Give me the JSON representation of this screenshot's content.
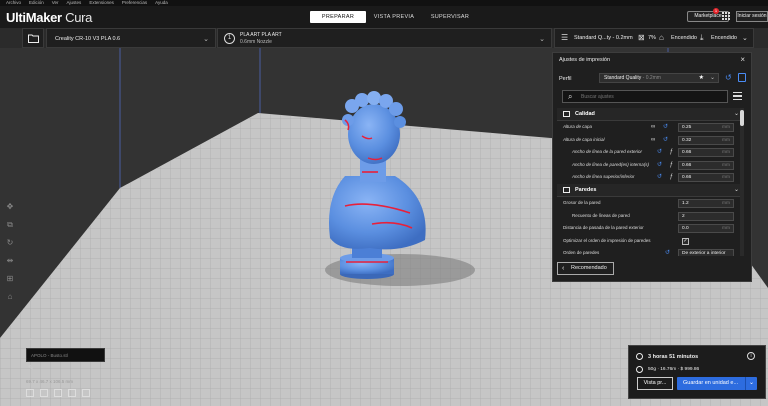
{
  "menu": [
    "Archivo",
    "Edición",
    "Ver",
    "Ajustes",
    "Extensiones",
    "Preferencias",
    "Ayuda"
  ],
  "app": {
    "brand_bold": "UltiMaker",
    "brand_light": " Cura"
  },
  "stages": [
    {
      "label": "PREPARAR",
      "active": true
    },
    {
      "label": "VISTA PREVIA",
      "active": false
    },
    {
      "label": "SUPERVISAR",
      "active": false
    }
  ],
  "header": {
    "marketplace": "Marketplace",
    "marketplace_badge": "1",
    "signin": "Iniciar sesión"
  },
  "toolbar": {
    "printer": "Creality CR-10 V3 PLA 0.6",
    "material_line1": "PLA ART PLA ART",
    "material_line2": "0.6mm Nozzle",
    "material_icon": "1",
    "quality": "Standard Q...ty - 0.2mm",
    "infill": "7%",
    "support": "Encendido",
    "adhesion": "Encendido"
  },
  "panel": {
    "title": "Ajustes de impresión",
    "profile_label": "Perfil",
    "profile_value": "Standard Quality",
    "profile_suffix": " - 0.2mm",
    "search_placeholder": "Buscar ajustes",
    "recommended": "Recomendado",
    "categories": [
      {
        "label": "Calidad",
        "rows": [
          {
            "label": "Altura de capa",
            "value": "0.25",
            "unit": "mm",
            "indent": 0,
            "italic": true,
            "icons": "link"
          },
          {
            "label": "Altura de capa inicial",
            "value": "0.32",
            "unit": "mm",
            "indent": 0,
            "italic": true,
            "icons": "link"
          },
          {
            "label": "Ancho de línea de la pared exterior",
            "value": "0.66",
            "unit": "mm",
            "indent": 1,
            "italic": true,
            "icons": "fx"
          },
          {
            "label": "Ancho de línea de pared(es) interna(s)",
            "value": "0.66",
            "unit": "mm",
            "indent": 1,
            "italic": true,
            "icons": "fx"
          },
          {
            "label": "Ancho de línea superior/inferior",
            "value": "0.66",
            "unit": "mm",
            "indent": 1,
            "italic": true,
            "icons": "fx"
          }
        ]
      },
      {
        "label": "Paredes",
        "rows": [
          {
            "label": "Grosor de la pared",
            "value": "1.2",
            "unit": "mm",
            "indent": 0,
            "italic": false,
            "icons": ""
          },
          {
            "label": "Recuento de líneas de pared",
            "value": "2",
            "unit": "",
            "indent": 1,
            "italic": false,
            "icons": ""
          },
          {
            "label": "Distancia de pasada de la pared exterior",
            "value": "0.0",
            "unit": "mm",
            "indent": 0,
            "italic": false,
            "icons": ""
          },
          {
            "label": "Optimizar el orden de impresión de paredes",
            "value": "✓",
            "unit": "",
            "indent": 0,
            "italic": false,
            "icons": "",
            "checkbox": true
          },
          {
            "label": "Orden de paredes",
            "value": "De exterior a interior",
            "unit": "",
            "indent": 0,
            "italic": false,
            "icons": "reset"
          }
        ]
      }
    ]
  },
  "object_list": {
    "name": "APOLO - Busto.stl",
    "dims": "69.7 x 46.7 x 106.5 mm"
  },
  "print_info": {
    "time": "3 horas 51 minutos",
    "material": "50g · 16.76m · $ 999.86",
    "preview": "Vista pr...",
    "save": "Guardar en unidad e..."
  },
  "colors": {
    "accent": "#2d6cdf",
    "model": "#5b8fe0",
    "overhang": "#e8203a",
    "plate": "#c8c8c8"
  }
}
